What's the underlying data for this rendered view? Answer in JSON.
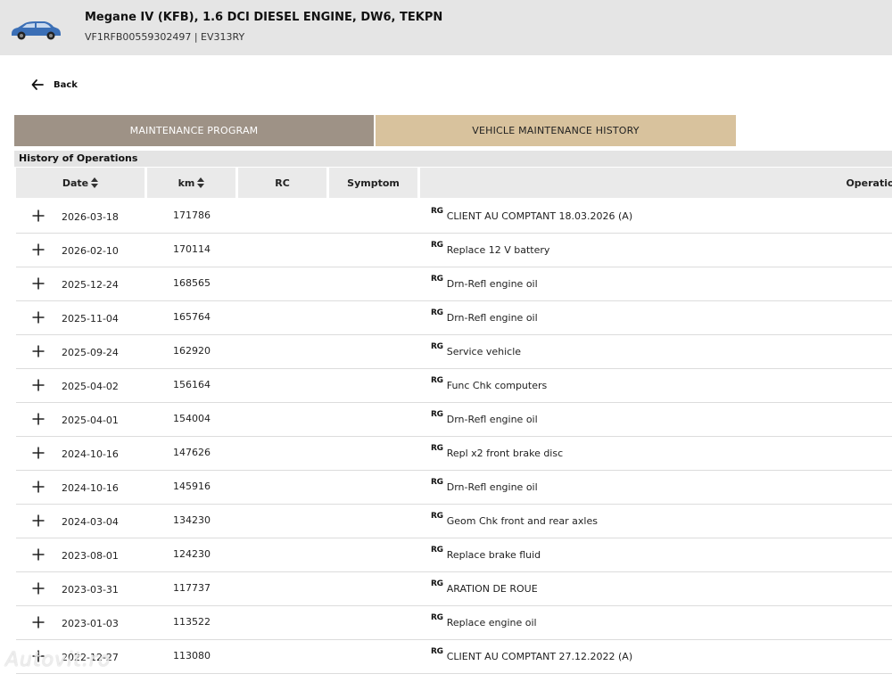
{
  "vehicle": {
    "title": "Megane IV (KFB), 1.6 DCI DIESEL ENGINE, DW6, TEKPN",
    "subtitle": "VF1RFB00559302497 | EV313RY"
  },
  "nav": {
    "back_label": "Back"
  },
  "tabs": [
    {
      "label": "MAINTENANCE PROGRAM",
      "active": false
    },
    {
      "label": "VEHICLE MAINTENANCE HISTORY",
      "active": true
    }
  ],
  "section_title": "History of Operations",
  "columns": {
    "date": "Date",
    "km": "km",
    "rc": "RC",
    "symptom": "Symptom",
    "operation": "Operation l"
  },
  "rg_label": "RG",
  "rows": [
    {
      "date": "2026-03-18",
      "km": "171786",
      "operation": "CLIENT AU COMPTANT 18.03.2026 (A)"
    },
    {
      "date": "2026-02-10",
      "km": "170114",
      "operation": "Replace 12 V battery"
    },
    {
      "date": "2025-12-24",
      "km": "168565",
      "operation": "Drn-Refl engine oil"
    },
    {
      "date": "2025-11-04",
      "km": "165764",
      "operation": "Drn-Refl engine oil"
    },
    {
      "date": "2025-09-24",
      "km": "162920",
      "operation": "Service vehicle"
    },
    {
      "date": "2025-04-02",
      "km": "156164",
      "operation": "Func Chk computers"
    },
    {
      "date": "2025-04-01",
      "km": "154004",
      "operation": "Drn-Refl engine oil"
    },
    {
      "date": "2024-10-16",
      "km": "147626",
      "operation": "Repl x2 front brake disc"
    },
    {
      "date": "2024-10-16",
      "km": "145916",
      "operation": "Drn-Refl engine oil"
    },
    {
      "date": "2024-03-04",
      "km": "134230",
      "operation": "Geom Chk front and rear axles"
    },
    {
      "date": "2023-08-01",
      "km": "124230",
      "operation": "Replace brake fluid"
    },
    {
      "date": "2023-03-31",
      "km": "117737",
      "operation": "ARATION DE ROUE"
    },
    {
      "date": "2023-01-03",
      "km": "113522",
      "operation": "Replace engine oil"
    },
    {
      "date": "2022-12-27",
      "km": "113080",
      "operation": "CLIENT AU COMPTANT 27.12.2022 (A)"
    }
  ],
  "watermark": "Autovit.ro",
  "colors": {
    "tab_inactive": "#9e9286",
    "tab_active": "#d8c29d",
    "header_bg": "#e5e5e5"
  }
}
